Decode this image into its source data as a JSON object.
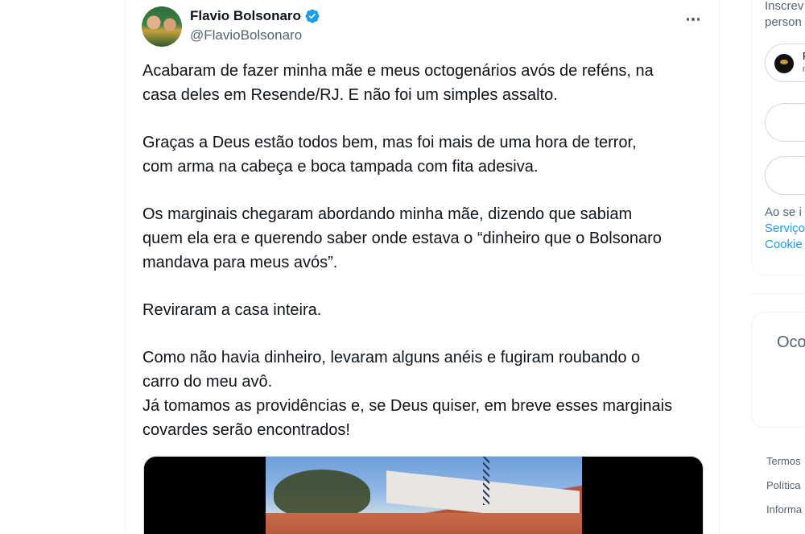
{
  "tweet": {
    "author_name": "Flavio Bolsonaro",
    "author_handle": "@FlavioBolsonaro",
    "text": "Acabaram de fazer minha mãe e meus octogenários avós de reféns, na\ncasa deles em Resende/RJ. E não foi um simples assalto.\n\nGraças a Deus estão todos bem, mas foi mais de uma hora de terror,\ncom arma na cabeça e boca tampada com fita adesiva.\n\nOs marginais chegaram abordando minha mãe, dizendo que sabiam\nquem ela era e querendo saber onde estava o “dinheiro que o Bolsonaro\nmandava para meus avós”.\n\nReviraram a casa inteira.\n\nComo não havia dinheiro, levaram alguns anéis e fugiram roubando o\ncarro do meu avô.\nJá tomamos as providências e, se Deus quiser, em breve esses marginais\ncovardes serão encontrados!"
  },
  "sidebar": {
    "signup_line1": "Inscrev",
    "signup_line2": "person",
    "google_initial": "F",
    "google_sub": "n",
    "terms_intro": "Ao se i",
    "terms_link1": "Serviço",
    "terms_link2": "Cookie",
    "trend_text": "Oco",
    "footer_link1": "Termos",
    "footer_link2": "Política",
    "footer_link3": "Informa"
  },
  "colors": {
    "text_primary": "#0f1419",
    "text_secondary": "#536471",
    "accent": "#1d9bf0",
    "border": "#eff3f4"
  }
}
